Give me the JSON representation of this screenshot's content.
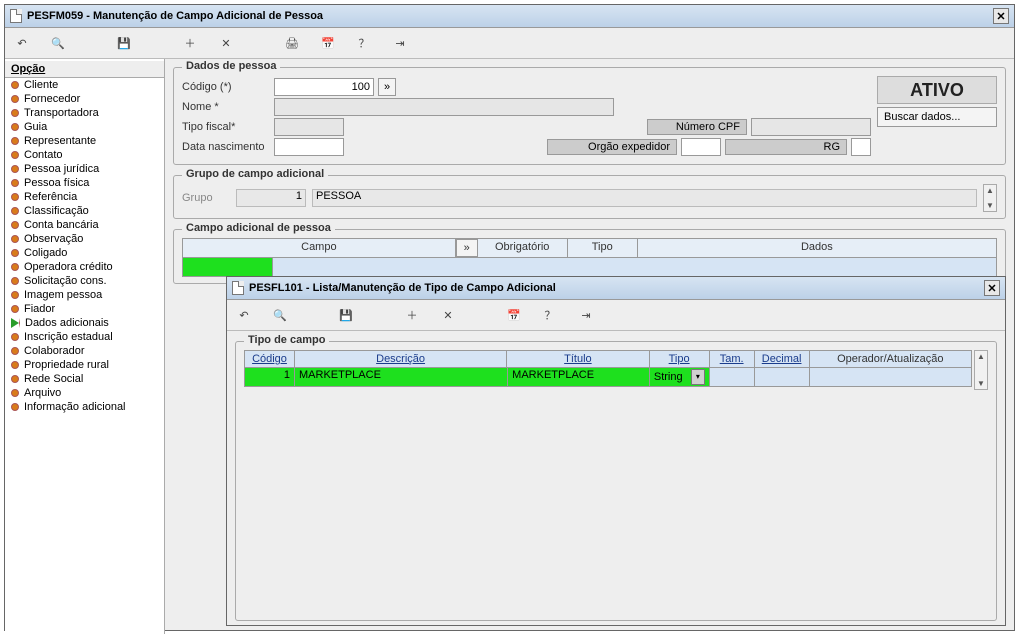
{
  "mainWindow": {
    "title": "PESFM059 - Manutenção de Campo Adicional de Pessoa"
  },
  "sidebar": {
    "heading": "Opção",
    "items": [
      {
        "label": "Cliente",
        "active": false
      },
      {
        "label": "Fornecedor",
        "active": false
      },
      {
        "label": "Transportadora",
        "active": false
      },
      {
        "label": "Guia",
        "active": false
      },
      {
        "label": "Representante",
        "active": false
      },
      {
        "label": "Contato",
        "active": false
      },
      {
        "label": "Pessoa jurídica",
        "active": false
      },
      {
        "label": "Pessoa física",
        "active": false
      },
      {
        "label": "Referência",
        "active": false
      },
      {
        "label": "Classificação",
        "active": false
      },
      {
        "label": "Conta bancária",
        "active": false
      },
      {
        "label": "Observação",
        "active": false
      },
      {
        "label": "Coligado",
        "active": false
      },
      {
        "label": "Operadora crédito",
        "active": false
      },
      {
        "label": "Solicitação cons.",
        "active": false
      },
      {
        "label": "Imagem pessoa",
        "active": false
      },
      {
        "label": "Fiador",
        "active": false
      },
      {
        "label": "Dados adicionais",
        "active": true
      },
      {
        "label": "Inscrição estadual",
        "active": false
      },
      {
        "label": "Colaborador",
        "active": false
      },
      {
        "label": "Propriedade rural",
        "active": false
      },
      {
        "label": "Rede Social",
        "active": false
      },
      {
        "label": "Arquivo",
        "active": false
      },
      {
        "label": "Informação adicional",
        "active": false
      }
    ]
  },
  "dadosPessoa": {
    "legend": "Dados de pessoa",
    "codigoLabel": "Código (*)",
    "codigoValue": "100",
    "nomeLabel": "Nome *",
    "tipoFiscalLabel": "Tipo fiscal*",
    "dataNascLabel": "Data nascimento",
    "numeroCpfLabel": "Número CPF",
    "orgaoExpedidorLabel": "Orgão expedidor",
    "rgLabel": "RG",
    "statusBadge": "ATIVO",
    "buscarDadosLabel": "Buscar dados...",
    "expandBtn": "»"
  },
  "grupoCampo": {
    "legend": "Grupo de campo adicional",
    "grupoLabel": "Grupo",
    "grupoCodigo": "1",
    "grupoNome": "PESSOA"
  },
  "campoAdicional": {
    "legend": "Campo adicional de pessoa",
    "headers": {
      "campo": "Campo",
      "hint": "»",
      "obrigatorio": "Obrigatório",
      "tipo": "Tipo",
      "dados": "Dados"
    }
  },
  "innerWindow": {
    "title": "PESFL101 - Lista/Manutenção de Tipo de Campo Adicional",
    "tipoCampo": {
      "legend": "Tipo de campo",
      "headers": {
        "codigo": "Código",
        "descricao": "Descrição",
        "titulo": "Título",
        "tipo": "Tipo",
        "tam": "Tam.",
        "decimal": "Decimal",
        "operador": "Operador/Atualização"
      },
      "row": {
        "codigo": "1",
        "descricao": "MARKETPLACE",
        "titulo": "MARKETPLACE",
        "tipo": "String",
        "tam": "",
        "decimal": "",
        "operador": ""
      }
    }
  }
}
